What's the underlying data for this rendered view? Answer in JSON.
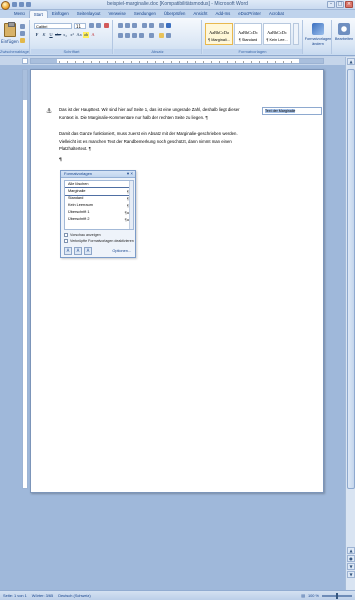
{
  "window": {
    "title": "beispiel-marginalie.doc [Kompatibilitätsmodus] - Microsoft Word"
  },
  "tabs": [
    "Menü",
    "Start",
    "Einfügen",
    "Seitenlayout",
    "Verweise",
    "Sendungen",
    "Überprüfen",
    "Ansicht",
    "Add-Ins",
    "eDocPrinter",
    "Acrobat"
  ],
  "ribbon": {
    "clipboard": {
      "paste_label": "Einfügen",
      "group_label": "Zwischenablage"
    },
    "font": {
      "name": "Calibri",
      "size": "11",
      "group_label": "Schriftart"
    },
    "paragraph": {
      "group_label": "Absatz"
    },
    "styles": {
      "group_label": "Formatvorlagen",
      "items": [
        {
          "sample": "AaBbCcDa",
          "name": "¶ Marginali..."
        },
        {
          "sample": "AaBbCcDc",
          "name": "¶ Standard"
        },
        {
          "sample": "AaBbCcDc",
          "name": "¶ Kein Lee..."
        }
      ],
      "change_label": "Formatvorlagen ändern"
    },
    "editing": {
      "label": "Bearbeiten"
    }
  },
  "document": {
    "para1": "Das ist der Haupttext. Wir sind hier auf Seite 1, das ist eine ungerade Zahl, deshalb liegt dieser Kontext in. Die Marginalie-Kommentare nur halb der rechten Seite zu liegen. ¶",
    "para2": "Damit das Ganze funktioniert, muss zuerst ein Absatz mit der Marginalie-geschrieben werden. Vielleicht ist es manchen Text der Randbemerkung noch geschützt, dann nimmt man einen Platzhaltertext. ¶",
    "pilcrow": "¶",
    "marginal_text": "Text der Marginalie"
  },
  "styles_panel": {
    "title": "Formatvorlagen",
    "items": [
      {
        "name": "Alle löschen",
        "mark": ""
      },
      {
        "name": "Marginalie",
        "mark": "¶"
      },
      {
        "name": "Standard",
        "mark": "¶"
      },
      {
        "name": "Kein Leerraum",
        "mark": "¶"
      },
      {
        "name": "Überschrift 1",
        "mark": "¶a"
      },
      {
        "name": "Überschrift 2",
        "mark": "¶a"
      }
    ],
    "selected_index": 1,
    "check_preview": "Vorschau anzeigen",
    "check_linked": "Verknüpfte Formatvorlagen deaktivieren",
    "options_label": "Optionen..."
  },
  "statusbar": {
    "page": "Seite: 1 von 1",
    "words": "Wörter: 3/65",
    "language": "Deutsch (Schweiz)",
    "zoom": "100 %"
  }
}
